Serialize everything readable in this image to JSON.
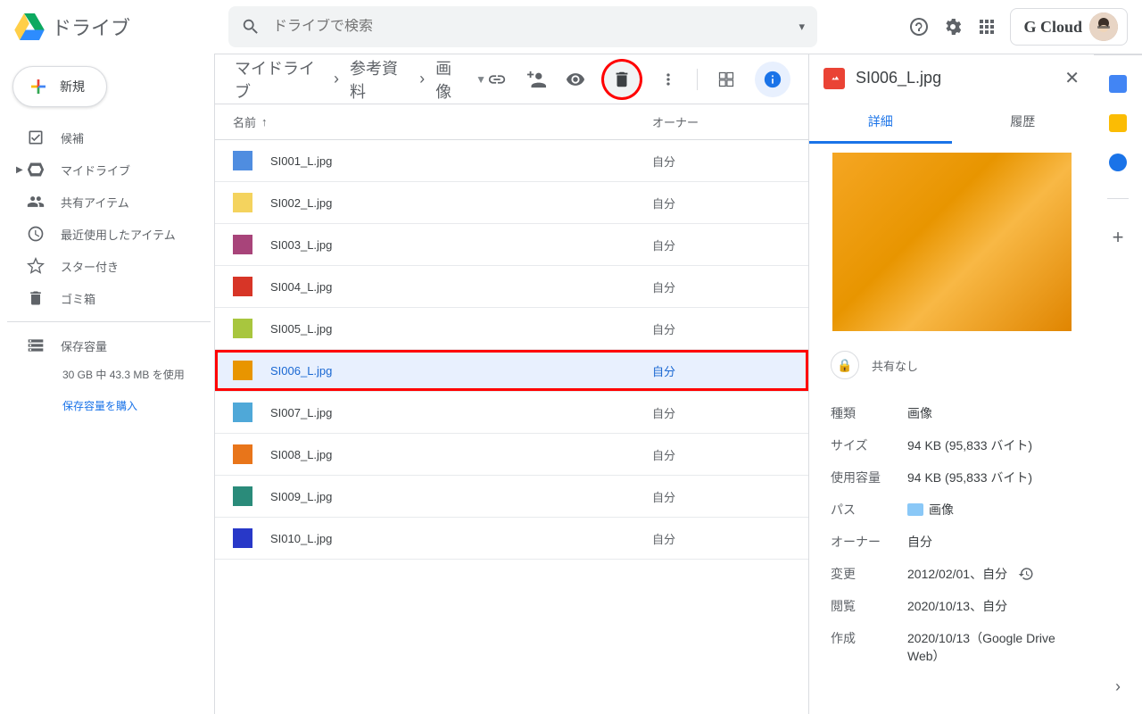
{
  "header": {
    "app_title": "ドライブ",
    "search_placeholder": "ドライブで検索",
    "account_label": "G Cloud"
  },
  "sidebar": {
    "new_label": "新規",
    "items": [
      {
        "label": "候補"
      },
      {
        "label": "マイドライブ"
      },
      {
        "label": "共有アイテム"
      },
      {
        "label": "最近使用したアイテム"
      },
      {
        "label": "スター付き"
      },
      {
        "label": "ゴミ箱"
      }
    ],
    "storage_label": "保存容量",
    "storage_text": "30 GB 中 43.3 MB を使用",
    "buy_label": "保存容量を購入"
  },
  "breadcrumb": {
    "items": [
      "マイドライブ",
      "参考資料",
      "画像"
    ]
  },
  "columns": {
    "name": "名前",
    "owner": "オーナー"
  },
  "files": [
    {
      "name": "SI001_L.jpg",
      "owner": "自分",
      "color": "#4f8de0"
    },
    {
      "name": "SI002_L.jpg",
      "owner": "自分",
      "color": "#f4d35e"
    },
    {
      "name": "SI003_L.jpg",
      "owner": "自分",
      "color": "#a8447a"
    },
    {
      "name": "SI004_L.jpg",
      "owner": "自分",
      "color": "#d73527"
    },
    {
      "name": "SI005_L.jpg",
      "owner": "自分",
      "color": "#a8c63e"
    },
    {
      "name": "SI006_L.jpg",
      "owner": "自分",
      "color": "#e89500",
      "selected": true
    },
    {
      "name": "SI007_L.jpg",
      "owner": "自分",
      "color": "#4fa8d8"
    },
    {
      "name": "SI008_L.jpg",
      "owner": "自分",
      "color": "#e8751a"
    },
    {
      "name": "SI009_L.jpg",
      "owner": "自分",
      "color": "#2a8b7a"
    },
    {
      "name": "SI010_L.jpg",
      "owner": "自分",
      "color": "#2838c8"
    }
  ],
  "details": {
    "title": "SI006_L.jpg",
    "tab_detail": "詳細",
    "tab_history": "履歴",
    "share_status": "共有なし",
    "meta": {
      "type_l": "種類",
      "type_v": "画像",
      "size_l": "サイズ",
      "size_v": "94 KB (95,833 バイト)",
      "usage_l": "使用容量",
      "usage_v": "94 KB (95,833 バイト)",
      "path_l": "パス",
      "path_v": "画像",
      "owner_l": "オーナー",
      "owner_v": "自分",
      "mod_l": "変更",
      "mod_v": "2012/02/01、自分",
      "view_l": "閲覧",
      "view_v": "2020/10/13、自分",
      "create_l": "作成",
      "create_v": "2020/10/13（Google Drive Web）"
    }
  }
}
